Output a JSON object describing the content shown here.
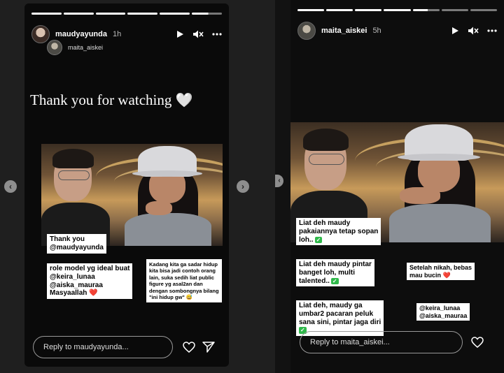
{
  "left_story": {
    "username": "maudyayunda",
    "time": "1h",
    "reshared_from": "maita_aiskei",
    "overlay_text": "Thank you for watching",
    "overlay_heart": "🤍",
    "captions": {
      "thank_you": [
        "Thank you",
        "@maudyayunda"
      ],
      "role_model": [
        "role model yg ideal buat",
        "@keira_lunaa",
        "@aiska_mauraa",
        "Masyaallah ❤️"
      ],
      "small_note": "Kadang kita ga sadar hidup kita bisa jadi contoh orang lain, suka sedih liat public figure yg asal2an dan dengan sombongnya bilang \"ini hidup gw\" 😅"
    },
    "reply_placeholder": "Reply to maudyayunda..."
  },
  "right_story": {
    "username": "maita_aiskei",
    "time": "5h",
    "captions": {
      "c1": [
        "Liat deh maudy",
        "pakaiannya tetap sopan",
        "loh.."
      ],
      "c2": [
        "Liat deh maudy pintar",
        "banget loh, multi",
        "talented.."
      ],
      "c3": [
        "Liat deh, maudy ga",
        "umbar2 pacaran peluk",
        "sana sini, pintar jaga diri"
      ],
      "c4": [
        "Setelah nikah, bebas",
        "mau bucin ❤️"
      ],
      "c5": [
        "@keira_lunaa",
        "@aiska_mauraa"
      ]
    },
    "check": "✓",
    "reply_placeholder": "Reply to maita_aiskei..."
  },
  "nav": {
    "prev": "‹",
    "next": "›"
  },
  "icons": [
    "play-icon",
    "mute-icon",
    "more-icon",
    "heart-icon",
    "send-icon",
    "chevron-left-icon",
    "chevron-right-icon"
  ],
  "colors": {
    "panel_bg": "#1f1f1f",
    "story_bg": "#0a0a0a",
    "caption_bg": "#ffffff",
    "check_green": "#2fb84a"
  }
}
